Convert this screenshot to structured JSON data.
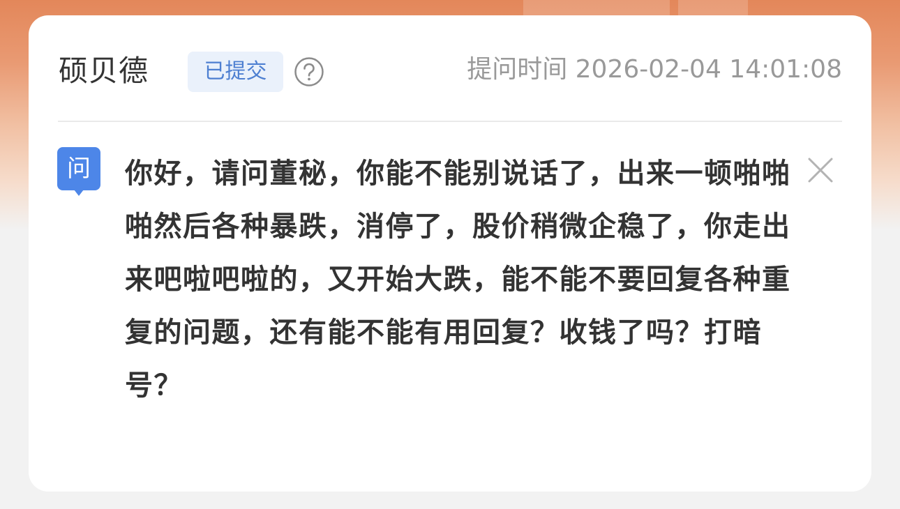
{
  "header": {
    "company_name": "硕贝德",
    "status_badge": "已提交",
    "help_icon": "question-circle-icon",
    "question_time": "提问时间 2026-02-04 14:01:08"
  },
  "question": {
    "tag_icon_label": "问",
    "text": "你好，请问董秘，你能不能别说话了，出来一顿啪啪啪然后各种暴跌，消停了，股价稍微企稳了，你走出来吧啦吧啦的，又开始大跌，能不能不要回复各种重复的问题，还有能不能有用回复？收钱了吗？打暗号？",
    "close_icon": "close-icon"
  },
  "colors": {
    "accent_blue": "#4d7fd1",
    "badge_bg": "#eaf1fb",
    "text_primary": "#333333",
    "text_secondary": "#999999",
    "background_orange": "#e3875a"
  }
}
